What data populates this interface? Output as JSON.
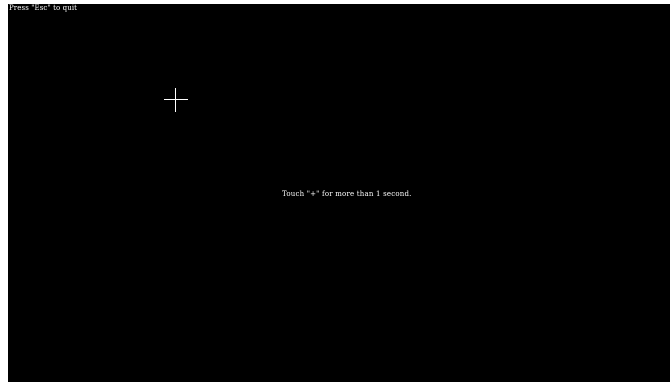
{
  "screen": {
    "background": "#000000",
    "text_color": "#ffffff"
  },
  "header": {
    "quit_hint": "Press \"Esc\" to quit"
  },
  "calibration": {
    "target_icon": "crosshair-icon",
    "instruction": "Touch \"+\" for more than 1 second."
  }
}
